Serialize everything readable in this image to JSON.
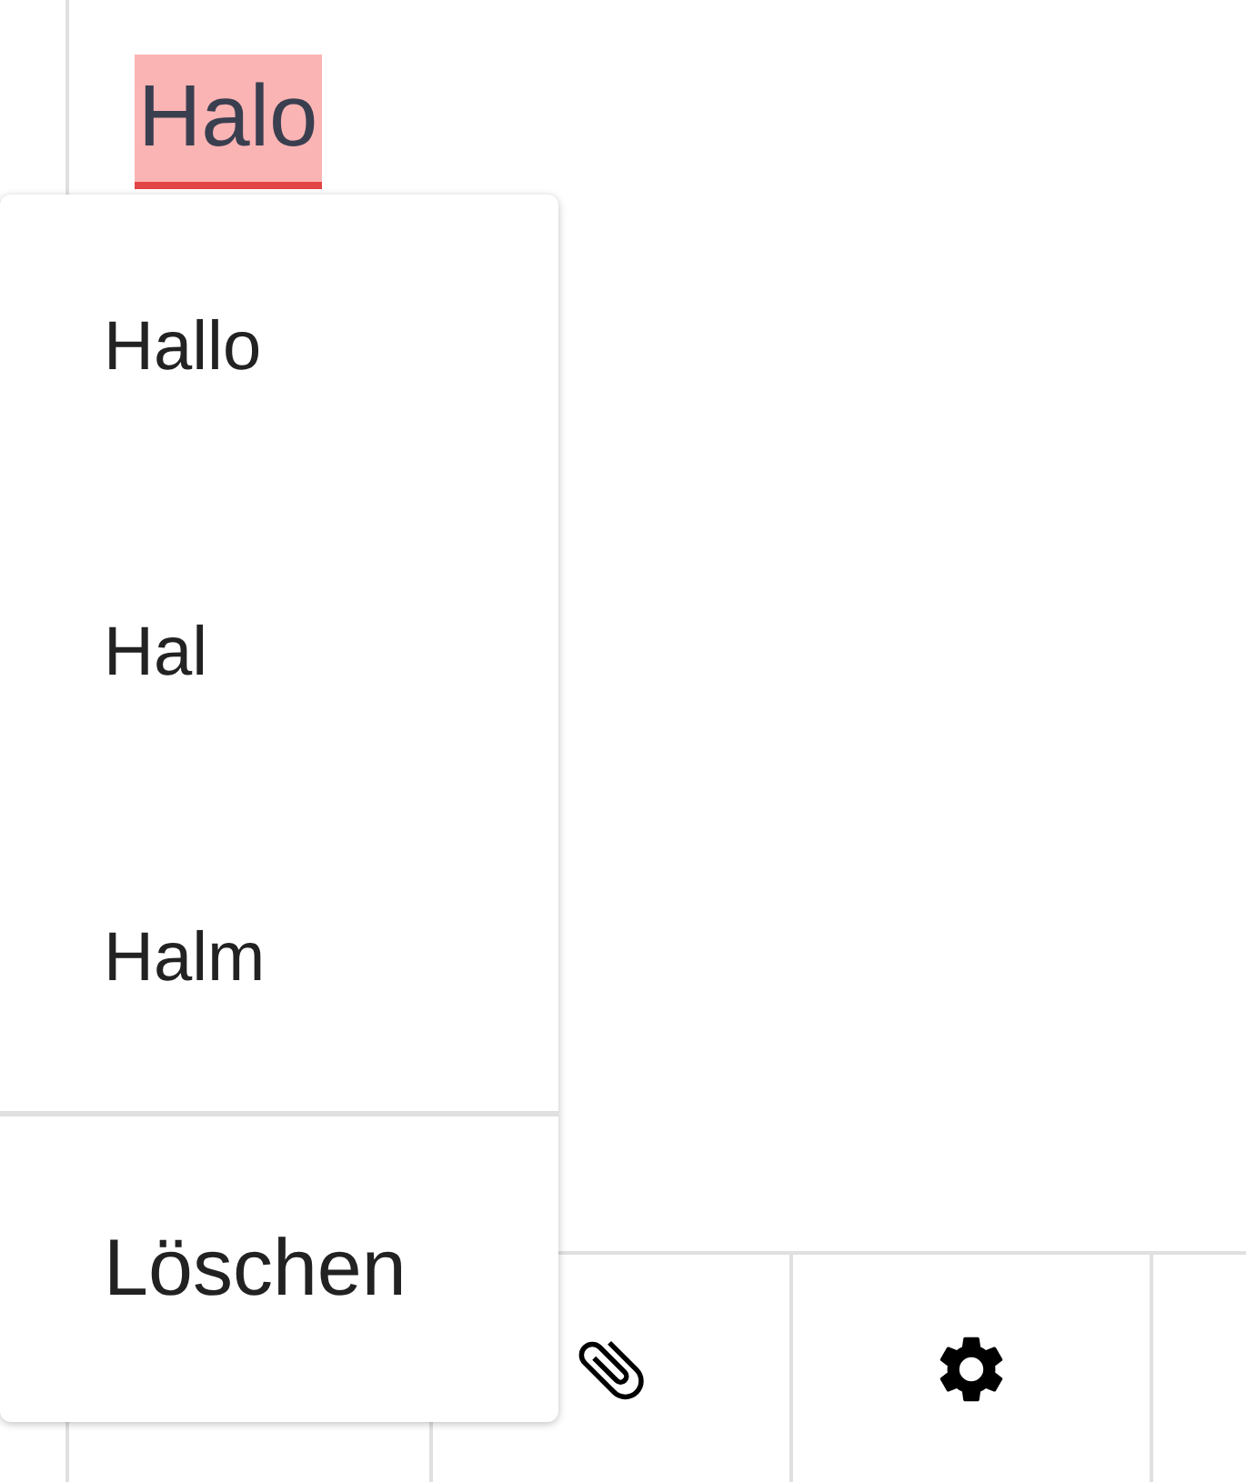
{
  "editor": {
    "misspelled_word": "Halo"
  },
  "spelling_menu": {
    "suggestions": [
      "Hallo",
      "Hal",
      "Halm"
    ],
    "delete_action": "Löschen"
  },
  "toolbar": {
    "buttons": [
      {
        "kind": "empty"
      },
      {
        "kind": "attachment"
      },
      {
        "kind": "settings"
      },
      {
        "kind": "empty"
      }
    ]
  }
}
